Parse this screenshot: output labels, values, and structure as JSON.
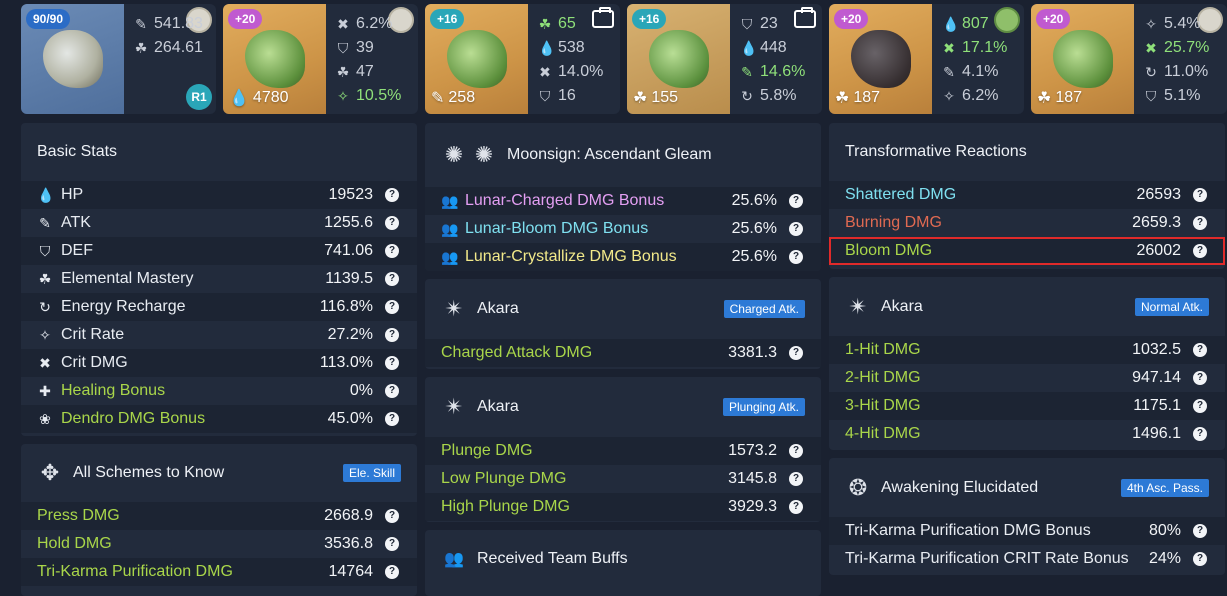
{
  "equipment": [
    {
      "badge": "90/90",
      "extra_badge": "R1",
      "main": "",
      "subs": [
        {
          "icon": "atk-icon",
          "glyph": "✎",
          "value": "541.83",
          "hi": false
        },
        {
          "icon": "elemental-mastery-icon",
          "glyph": "☘",
          "value": "264.61",
          "hi": false
        }
      ]
    },
    {
      "badge": "+20",
      "main": "4780",
      "main_icon": "hp-icon",
      "subs": [
        {
          "icon": "crit-dmg-icon",
          "glyph": "✖",
          "value": "6.2%",
          "hi": false
        },
        {
          "icon": "def-icon",
          "glyph": "⛉",
          "value": "39",
          "hi": false
        },
        {
          "icon": "elemental-mastery-icon",
          "glyph": "☘",
          "value": "47",
          "hi": false
        },
        {
          "icon": "crit-rate-icon",
          "glyph": "✧",
          "value": "10.5%",
          "hi": true
        }
      ]
    },
    {
      "badge": "+16",
      "main": "258",
      "main_icon": "atk-icon",
      "subs": [
        {
          "icon": "elemental-mastery-icon",
          "glyph": "☘",
          "value": "65",
          "hi": true
        },
        {
          "icon": "hp-icon",
          "glyph": "💧",
          "value": "538",
          "hi": false
        },
        {
          "icon": "crit-dmg-icon",
          "glyph": "✖",
          "value": "14.0%",
          "hi": false
        },
        {
          "icon": "def-icon",
          "glyph": "⛉",
          "value": "16",
          "hi": false
        }
      ]
    },
    {
      "badge": "+16",
      "main": "155",
      "main_icon": "elemental-mastery-icon",
      "subs": [
        {
          "icon": "def-icon",
          "glyph": "⛉",
          "value": "23",
          "hi": false
        },
        {
          "icon": "hp-icon",
          "glyph": "💧",
          "value": "448",
          "hi": false
        },
        {
          "icon": "atk-icon",
          "glyph": "✎",
          "value": "14.6%",
          "hi": true
        },
        {
          "icon": "energy-recharge-icon",
          "glyph": "↻",
          "value": "5.8%",
          "hi": false
        }
      ]
    },
    {
      "badge": "+20",
      "main": "187",
      "main_icon": "elemental-mastery-icon",
      "subs": [
        {
          "icon": "hp-icon",
          "glyph": "💧",
          "value": "807",
          "hi": true
        },
        {
          "icon": "crit-dmg-icon",
          "glyph": "✖",
          "value": "17.1%",
          "hi": true
        },
        {
          "icon": "atk-icon",
          "glyph": "✎",
          "value": "4.1%",
          "hi": false
        },
        {
          "icon": "crit-rate-icon",
          "glyph": "✧",
          "value": "6.2%",
          "hi": false
        }
      ]
    },
    {
      "badge": "+20",
      "main": "187",
      "main_icon": "elemental-mastery-icon",
      "subs": [
        {
          "icon": "crit-rate-icon",
          "glyph": "✧",
          "value": "5.4%",
          "hi": false
        },
        {
          "icon": "crit-dmg-icon",
          "glyph": "✖",
          "value": "25.7%",
          "hi": true
        },
        {
          "icon": "energy-recharge-icon",
          "glyph": "↻",
          "value": "11.0%",
          "hi": false
        },
        {
          "icon": "def-icon",
          "glyph": "⛉",
          "value": "5.1%",
          "hi": false
        }
      ]
    }
  ],
  "basic_stats": {
    "title": "Basic Stats",
    "rows": [
      {
        "icon": "hp-icon",
        "glyph": "💧",
        "label": "HP",
        "value": "19523",
        "color": ""
      },
      {
        "icon": "atk-icon",
        "glyph": "✎",
        "label": "ATK",
        "value": "1255.6",
        "color": ""
      },
      {
        "icon": "def-icon",
        "glyph": "⛉",
        "label": "DEF",
        "value": "741.06",
        "color": ""
      },
      {
        "icon": "elemental-mastery-icon",
        "glyph": "☘",
        "label": "Elemental Mastery",
        "value": "1139.5",
        "color": ""
      },
      {
        "icon": "energy-recharge-icon",
        "glyph": "↻",
        "label": "Energy Recharge",
        "value": "116.8%",
        "color": ""
      },
      {
        "icon": "crit-rate-icon",
        "glyph": "✧",
        "label": "Crit Rate",
        "value": "27.2%",
        "color": ""
      },
      {
        "icon": "crit-dmg-icon",
        "glyph": "✖",
        "label": "Crit DMG",
        "value": "113.0%",
        "color": ""
      },
      {
        "icon": "healing-bonus-icon",
        "glyph": "✚",
        "label": "Healing Bonus",
        "value": "0%",
        "color": "green"
      },
      {
        "icon": "dendro-icon",
        "glyph": "❀",
        "label": "Dendro DMG Bonus",
        "value": "45.0%",
        "color": "green"
      }
    ]
  },
  "schemes": {
    "title": "All Schemes to Know",
    "tag": "Ele. Skill",
    "rows": [
      {
        "label": "Press DMG",
        "value": "2668.9"
      },
      {
        "label": "Hold DMG",
        "value": "3536.8"
      },
      {
        "label": "Tri-Karma Purification DMG",
        "value": "14764"
      }
    ]
  },
  "moonsign": {
    "title": "Moonsign: Ascendant Gleam",
    "rows": [
      {
        "label": "Lunar-Charged DMG Bonus",
        "value": "25.6%",
        "color": "pinkt"
      },
      {
        "label": "Lunar-Bloom DMG Bonus",
        "value": "25.6%",
        "color": "cyan"
      },
      {
        "label": "Lunar-Crystallize DMG Bonus",
        "value": "25.6%",
        "color": "yellowt"
      }
    ]
  },
  "akara_charged": {
    "title": "Akara",
    "tag": "Charged Atk.",
    "rows": [
      {
        "label": "Charged Attack DMG",
        "value": "3381.3"
      }
    ]
  },
  "akara_plunging": {
    "title": "Akara",
    "tag": "Plunging Atk.",
    "rows": [
      {
        "label": "Plunge DMG",
        "value": "1573.2"
      },
      {
        "label": "Low Plunge DMG",
        "value": "3145.8"
      },
      {
        "label": "High Plunge DMG",
        "value": "3929.3"
      }
    ]
  },
  "team_buffs": {
    "title": "Received Team Buffs"
  },
  "transformative": {
    "title": "Transformative Reactions",
    "rows": [
      {
        "label": "Shattered DMG",
        "value": "26593",
        "color": "cyan"
      },
      {
        "label": "Burning DMG",
        "value": "2659.3",
        "color": "red"
      },
      {
        "label": "Bloom DMG",
        "value": "26002",
        "color": "green"
      }
    ]
  },
  "akara_normal": {
    "title": "Akara",
    "tag": "Normal Atk.",
    "rows": [
      {
        "label": "1-Hit DMG",
        "value": "1032.5"
      },
      {
        "label": "2-Hit DMG",
        "value": "947.14"
      },
      {
        "label": "3-Hit DMG",
        "value": "1175.1"
      },
      {
        "label": "4-Hit DMG",
        "value": "1496.1"
      }
    ]
  },
  "awakening": {
    "title": "Awakening Elucidated",
    "tag": "4th Asc. Pass.",
    "rows": [
      {
        "label": "Tri-Karma Purification DMG Bonus",
        "value": "80%"
      },
      {
        "label": "Tri-Karma Purification CRIT Rate Bonus",
        "value": "24%"
      }
    ]
  },
  "help_glyph": "?"
}
